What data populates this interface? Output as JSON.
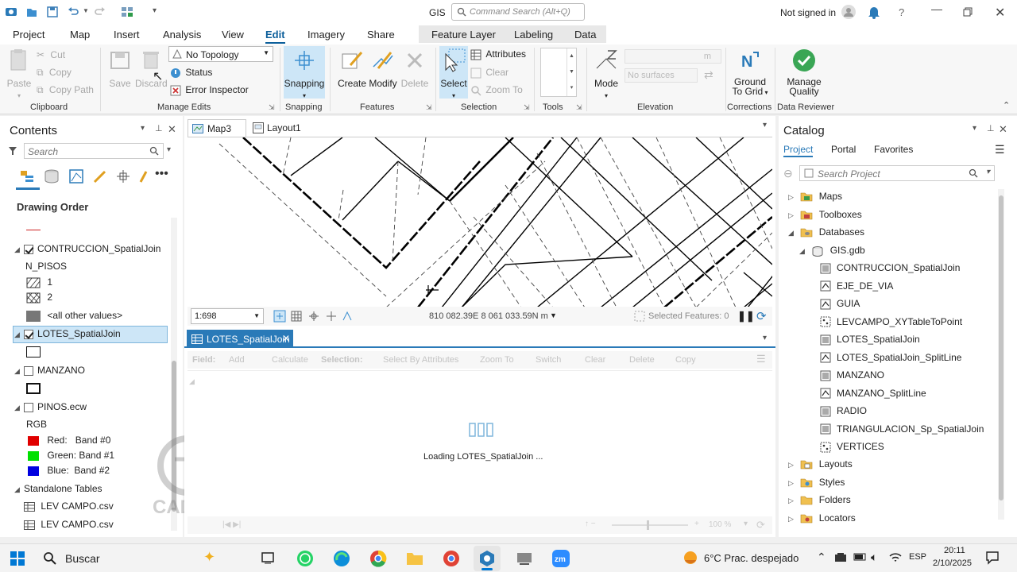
{
  "titlebar": {
    "app_name": "GIS",
    "command_search_placeholder": "Command Search (Alt+Q)",
    "signin": "Not signed in",
    "help": "?"
  },
  "ribbon_tabs": [
    "Project",
    "Map",
    "Insert",
    "Analysis",
    "View",
    "Edit",
    "Imagery",
    "Share"
  ],
  "contextual_tabs": [
    "Feature Layer",
    "Labeling",
    "Data"
  ],
  "ribbon": {
    "clipboard": {
      "paste": "Paste",
      "cut": "Cut",
      "copy": "Copy",
      "copy_path": "Copy Path",
      "label": "Clipboard"
    },
    "manage_edits": {
      "save": "Save",
      "discard": "Discard",
      "topology": "No Topology",
      "status": "Status",
      "error_inspector": "Error Inspector",
      "label": "Manage Edits"
    },
    "snapping": {
      "snapping": "Snapping",
      "label": "Snapping"
    },
    "features": {
      "create": "Create",
      "modify": "Modify",
      "delete": "Delete",
      "label": "Features"
    },
    "selection": {
      "select": "Select",
      "attributes": "Attributes",
      "clear": "Clear",
      "zoom_to": "Zoom To",
      "label": "Selection"
    },
    "tools": {
      "label": "Tools"
    },
    "elevation": {
      "mode": "Mode",
      "surfaces": "No surfaces",
      "units": "m",
      "label": "Elevation"
    },
    "corrections": {
      "ground_to_grid": "Ground To Grid",
      "label": "Corrections"
    },
    "data_reviewer": {
      "manage_quality": "Manage Quality",
      "label": "Data Reviewer"
    }
  },
  "contents": {
    "title": "Contents",
    "search_placeholder": "Search",
    "drawing_order": "Drawing Order",
    "layers": [
      {
        "name": "CONTRUCCION_SpatialJoin",
        "checked": true,
        "field": "N_PISOS",
        "classes": [
          "1",
          "2",
          "<all other values>"
        ]
      },
      {
        "name": "LOTES_SpatialJoin",
        "checked": true,
        "selected": true
      },
      {
        "name": "MANZANO",
        "checked": false
      },
      {
        "name": "PINOS.ecw",
        "checked": false,
        "rgb_label": "RGB",
        "bands": [
          "Red:   Band #0",
          "Green: Band #1",
          "Blue:  Band #2"
        ]
      }
    ],
    "band_colors": [
      "#e00000",
      "#00e000",
      "#0000e0"
    ],
    "standalone_tables": "Standalone Tables",
    "tables": [
      "LEV CAMPO.csv",
      "LEV CAMPO.csv"
    ]
  },
  "map": {
    "tabs": [
      "Map3",
      "Layout1"
    ],
    "scale": "1:698",
    "coordinates": "810 082.39E 8 061 033.59N m",
    "selected_features": "Selected Features: 0"
  },
  "table_view": {
    "tab": "LOTES_SpatialJoin",
    "toolbar": [
      "Field:",
      "Add",
      "Calculate",
      "Selection:",
      "Select By Attributes",
      "Zoom To",
      "Switch",
      "Clear",
      "Delete",
      "Copy"
    ],
    "loading": "Loading LOTES_SpatialJoin ...",
    "zoom": "100 %"
  },
  "catalog": {
    "title": "Catalog",
    "tabs": [
      "Project",
      "Portal",
      "Favorites"
    ],
    "search_placeholder": "Search Project",
    "items": {
      "maps": "Maps",
      "toolboxes": "Toolboxes",
      "databases": "Databases",
      "gdb": "GIS.gdb"
    },
    "gdb_items": [
      "CONTRUCCION_SpatialJoin",
      "EJE_DE_VIA",
      "GUIA",
      "LEVCAMPO_XYTableToPoint",
      "LOTES_SpatialJoin",
      "LOTES_SpatialJoin_SplitLine",
      "MANZANO",
      "MANZANO_SplitLine",
      "RADIO",
      "TRIANGULACION_Sp_SpatialJoin",
      "VERTICES"
    ],
    "bottom_items": [
      "Layouts",
      "Styles",
      "Folders",
      "Locators"
    ]
  },
  "taskbar": {
    "search": "Buscar",
    "weather": "6°C  Prac. despejado",
    "lang": "ESP",
    "time": "20:11",
    "date": "2/10/2025"
  }
}
